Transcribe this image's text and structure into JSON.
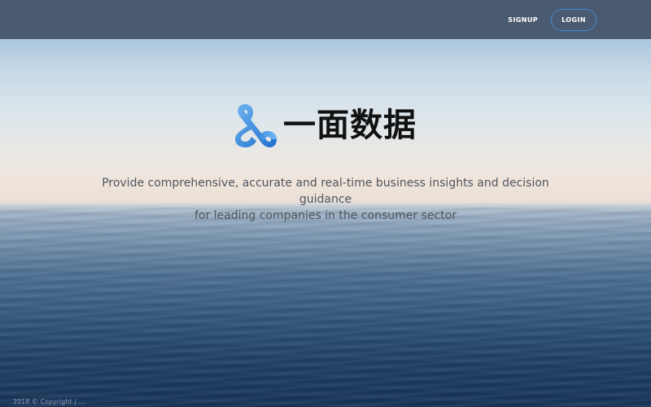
{
  "nav": {
    "signup_label": "SIGNUP",
    "login_label": "LOGIN"
  },
  "brand": {
    "name": "一面数据",
    "logo_icon": "ampersand-logo-icon",
    "accent_color": "#3f8ed8"
  },
  "hero": {
    "tagline_line1": "Provide comprehensive, accurate and real-time business insights and decision guidance",
    "tagline_line2": "for leading companies in the consumer sector"
  },
  "footer": {
    "copyright": "2018 © Copyright | …"
  }
}
